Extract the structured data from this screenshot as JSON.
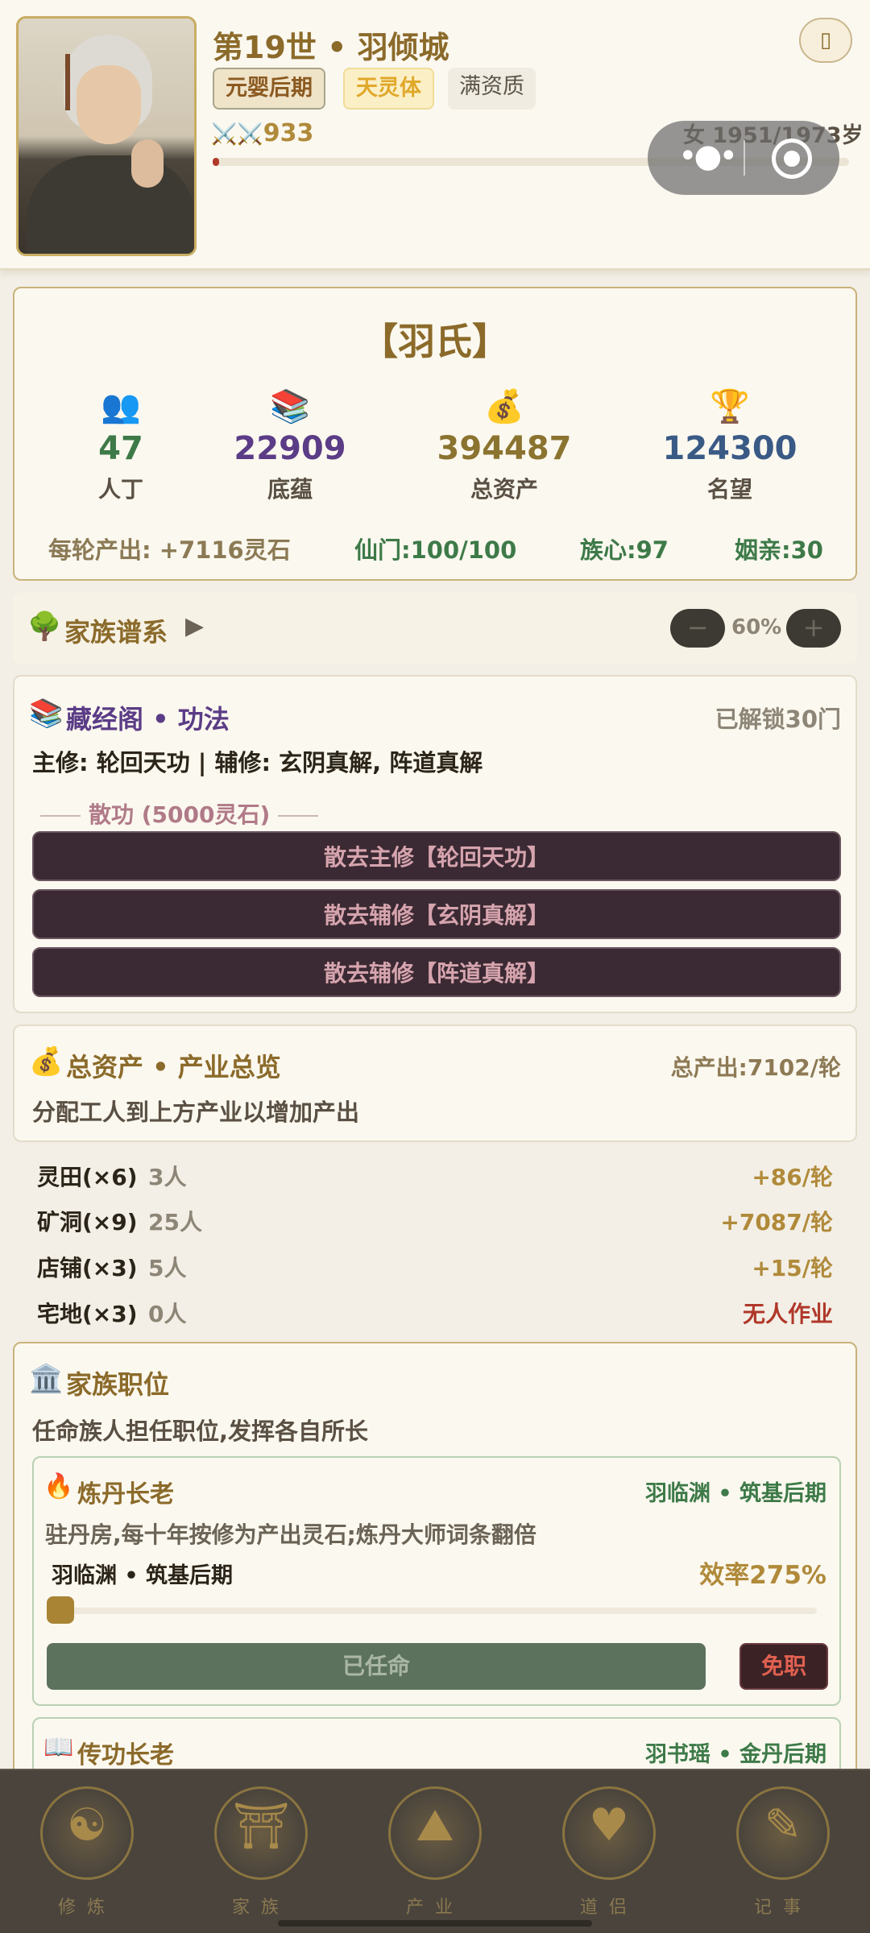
{
  "header": {
    "generation_title": "第19世 • 羽倾城",
    "realm_tag": "元婴后期",
    "body_tag": "天灵体",
    "talent_tag": "满资质",
    "power_icon": "crossed-swords-icon",
    "power_value": "933",
    "age_text": "女 1951/1973岁",
    "lifespan_fraction": 0.0,
    "settings_icon": "settings-icon"
  },
  "clan": {
    "name": "【羽氏】",
    "stats": [
      {
        "icon": "people-icon",
        "value": "47",
        "label": "人丁"
      },
      {
        "icon": "books-icon",
        "value": "22909",
        "label": "底蕴"
      },
      {
        "icon": "money-bag-icon",
        "value": "394487",
        "label": "总资产"
      },
      {
        "icon": "trophy-icon",
        "value": "124300",
        "label": "名望"
      }
    ],
    "output_per_round": "每轮产出: +7116灵石",
    "sect": "仙门:100/100",
    "clan_heart": "族心:97",
    "marriage": "姻亲:30"
  },
  "lineage": {
    "title": "家族谱系",
    "arrow": "▶",
    "zoom_minus": "−",
    "zoom": "60%",
    "zoom_plus": "+"
  },
  "library": {
    "title": "藏经阁 • 功法",
    "unlocked": "已解锁30门",
    "main_line": "主修: 轮回天功 | 辅修: 玄阴真解, 阵道真解",
    "disperse_header": "散功 (5000灵石)",
    "buttons": [
      "散去主修【轮回天功】",
      "散去辅修【玄阴真解】",
      "散去辅修【阵道真解】"
    ]
  },
  "assets": {
    "title": "总资产 • 产业总览",
    "total": "总产出:7102/轮",
    "hint": "分配工人到上方产业以增加产出",
    "rows": [
      {
        "name": "灵田(×6)",
        "workers": "3人",
        "output": "+86/轮"
      },
      {
        "name": "矿洞(×9)",
        "workers": "25人",
        "output": "+7087/轮"
      },
      {
        "name": "店铺(×3)",
        "workers": "5人",
        "output": "+15/轮"
      },
      {
        "name": "宅地(×3)",
        "workers": "0人",
        "output": "无人作业"
      }
    ]
  },
  "positions": {
    "title": "家族职位",
    "hint": "任命族人担任职位,发挥各自所长",
    "elder": {
      "title": "炼丹长老",
      "holder": "羽临渊 • 筑基后期",
      "desc": "驻丹房,每十年按修为产出灵石;炼丹大师词条翻倍",
      "person": "羽临渊 • 筑基后期",
      "efficiency": "效率275%",
      "slider_fraction": 0.0,
      "appointed_label": "已任命",
      "dismiss_label": "免职"
    },
    "elder2": {
      "title": "传功长老",
      "holder": "羽书瑶 • 金丹后期"
    }
  },
  "nav": [
    {
      "label": "修炼",
      "icon": "meditation-icon"
    },
    {
      "label": "家族",
      "icon": "pavilion-icon"
    },
    {
      "label": "产业",
      "icon": "mountain-icon"
    },
    {
      "label": "道侣",
      "icon": "couple-icon"
    },
    {
      "label": "记事",
      "icon": "scroll-icon"
    }
  ]
}
